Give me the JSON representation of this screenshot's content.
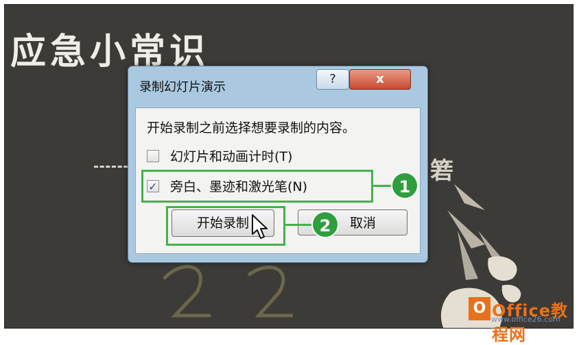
{
  "slide": {
    "title": "应急小常识",
    "bg_char": "箬"
  },
  "dialog": {
    "title": "录制幻灯片演示",
    "help_label": "?",
    "close_label": "x",
    "prompt": "开始录制之前选择想要录制的内容。",
    "options": [
      {
        "label": "幻灯片和动画计时(T)",
        "checked": false
      },
      {
        "label": "旁白、墨迹和激光笔(N)",
        "checked": true
      }
    ],
    "check_mark": "✓",
    "start_label": "开始录制",
    "cancel_label": "取消"
  },
  "annotations": {
    "badge1": "1",
    "badge2": "2",
    "highlight_color": "#46b04a"
  },
  "watermark": {
    "logo_letter": "O",
    "brand": "Office教程网",
    "url": "www.office26.com"
  }
}
